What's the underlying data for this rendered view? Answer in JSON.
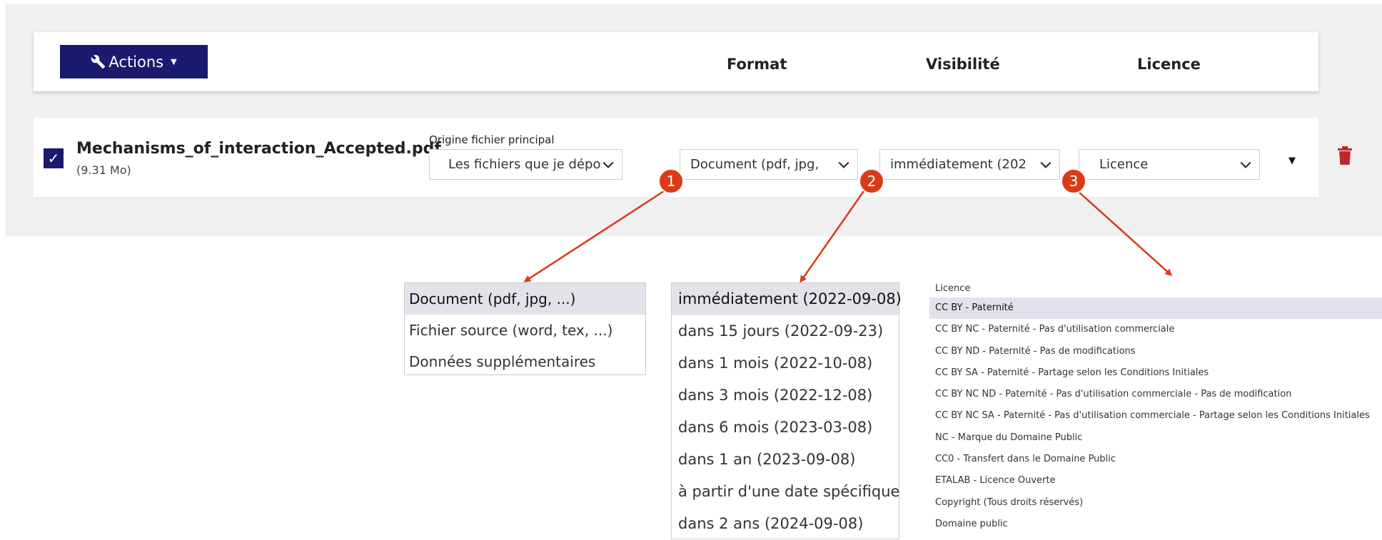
{
  "header": {
    "actions_label": "Actions",
    "col_format": "Format",
    "col_visibility": "Visibilité",
    "col_licence": "Licence"
  },
  "file": {
    "checked": true,
    "name": "Mechanisms_of_interaction_Accepted.pdf",
    "size": "(9.31 Mo)",
    "origin_label": "Origine fichier principal",
    "origin_value": "Les fichiers que je dépose sc",
    "format_value": "Document (pdf, jpg,",
    "visibility_value": "immédiatement (202",
    "licence_value": "Licence"
  },
  "badges": [
    "1",
    "2",
    "3"
  ],
  "format_options": [
    "Document (pdf, jpg, ...)",
    "Fichier source (word, tex, ...)",
    "Données supplémentaires"
  ],
  "visibility_options": [
    "immédiatement (2022-09-08)",
    "dans 15 jours (2022-09-23)",
    "dans 1 mois (2022-10-08)",
    "dans 3 mois (2022-12-08)",
    "dans 6 mois (2023-03-08)",
    "dans 1 an (2023-09-08)",
    "à partir d'une date spécifique",
    "dans 2 ans (2024-09-08)"
  ],
  "licence_options": {
    "header": "Licence",
    "items": [
      "CC BY - Paternité",
      "CC BY NC - Paternité - Pas d'utilisation commerciale",
      "CC BY ND - Paternité - Pas de modifications",
      "CC BY SA - Paternité - Partage selon les Conditions Initiales",
      "CC BY NC ND - Paternité - Pas d'utilisation commerciale - Pas de modification",
      "CC BY NC SA - Paternité - Pas d'utilisation commerciale - Partage selon les Conditions Initiales",
      "NC - Marque du Domaine Public",
      "CC0 - Transfert dans le Domaine Public",
      "ETALAB - Licence Ouverte",
      "Copyright (Tous droits réservés)",
      "Domaine public"
    ]
  },
  "colors": {
    "primary": "#1a1a6e",
    "badge": "#d93b16",
    "trash": "#c0272d",
    "selected_option": "#e2e2ea"
  }
}
